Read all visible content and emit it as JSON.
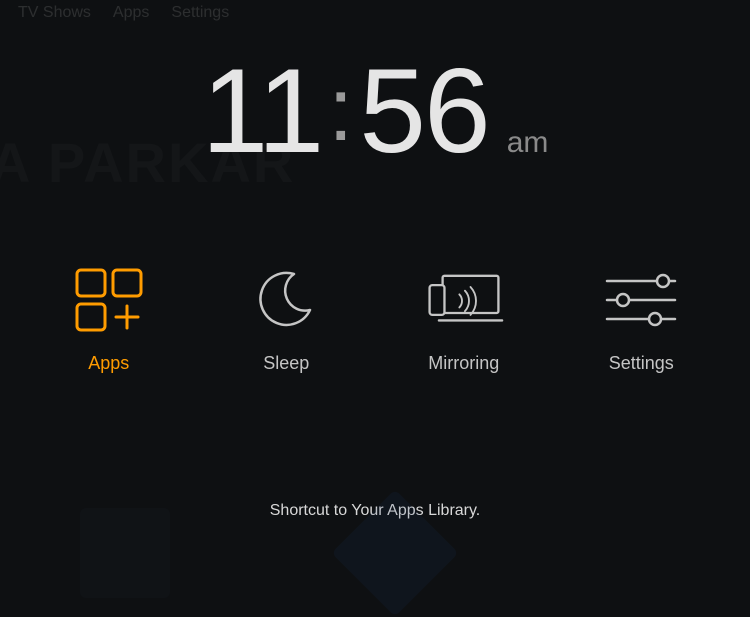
{
  "top_nav": {
    "items": [
      "TV Shows",
      "Apps",
      "Settings"
    ]
  },
  "clock": {
    "hours": "11",
    "minutes": "56",
    "colon": ":",
    "ampm": "am"
  },
  "tiles": [
    {
      "id": "apps",
      "label": "Apps",
      "selected": true,
      "icon": "apps-icon"
    },
    {
      "id": "sleep",
      "label": "Sleep",
      "selected": false,
      "icon": "sleep-icon"
    },
    {
      "id": "mirroring",
      "label": "Mirroring",
      "selected": false,
      "icon": "mirroring-icon"
    },
    {
      "id": "settings",
      "label": "Settings",
      "selected": false,
      "icon": "settings-icon"
    }
  ],
  "description": "Shortcut to Your Apps Library.",
  "background_text": "A PARKAR",
  "colors": {
    "accent": "#ff9c00",
    "text": "#c5c5c5",
    "muted": "#8a8a8a"
  }
}
